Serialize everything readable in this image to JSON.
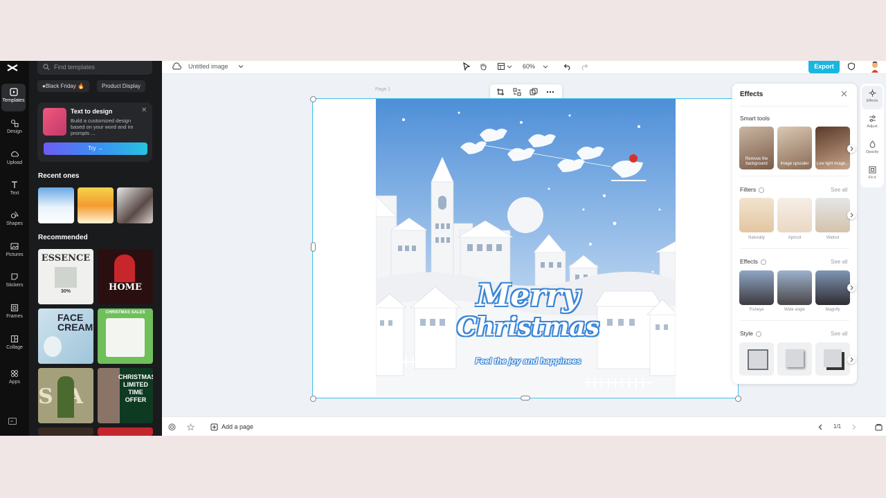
{
  "sidebar": {
    "items": [
      {
        "label": "Templates",
        "icon": "template-icon"
      },
      {
        "label": "Design",
        "icon": "design-icon"
      },
      {
        "label": "Upload",
        "icon": "upload-icon"
      },
      {
        "label": "Text",
        "icon": "text-icon"
      },
      {
        "label": "Shapes",
        "icon": "shapes-icon"
      },
      {
        "label": "Pictures",
        "icon": "pictures-icon"
      },
      {
        "label": "Stickers",
        "icon": "stickers-icon"
      },
      {
        "label": "Frames",
        "icon": "frames-icon"
      },
      {
        "label": "Collage",
        "icon": "collage-icon"
      },
      {
        "label": "Apps",
        "icon": "apps-icon"
      }
    ]
  },
  "templates": {
    "search_placeholder": "Find templates",
    "chips": [
      "●Black Friday 🔥",
      "Product Display"
    ],
    "promo": {
      "title": "Text to design",
      "desc": "Build a customized design based on your word and im prompts ...",
      "button": "Try →"
    },
    "recent_title": "Recent ones",
    "recommended_title": "Recommended",
    "recommended_texts": [
      "ESSENCE",
      "30%",
      "HOME",
      "FACE CREAM",
      "CHRISTMAS SALES",
      "SALE",
      "CHRISTMAS LIMITED TIME OFFER"
    ]
  },
  "toolbar": {
    "title": "Untitled image",
    "zoom": "60%",
    "export_label": "Export"
  },
  "canvas": {
    "page_label": "Page 1",
    "merry": "Merry",
    "christmas": "Christmas",
    "tagline": "Feel the joy and happinees"
  },
  "effects": {
    "title": "Effects",
    "smart_tools_title": "Smart tools",
    "smart_tools": [
      "Remove the background",
      "Image upscaler",
      "Low light image..."
    ],
    "filters_title": "Filters",
    "filters": [
      "Naturally",
      "Apricot",
      "Walnut"
    ],
    "effects_title": "Effects",
    "effects": [
      "Fisheye",
      "Wide angle",
      "Magnify"
    ],
    "style_title": "Style",
    "see_all": "See all"
  },
  "right_rail": [
    {
      "label": "Effects",
      "icon": "effects-icon"
    },
    {
      "label": "Adjust",
      "icon": "adjust-icon"
    },
    {
      "label": "Opacity",
      "icon": "opacity-icon"
    },
    {
      "label": "Fit it",
      "icon": "fit-icon"
    }
  ],
  "bottom": {
    "add_page": "Add a page",
    "page_indicator": "1/1"
  },
  "colors": {
    "accent": "#19b6e0",
    "selection": "#3fc2e8",
    "panel_dark": "#1a1b1d",
    "sky_top": "#4e8fd8"
  }
}
